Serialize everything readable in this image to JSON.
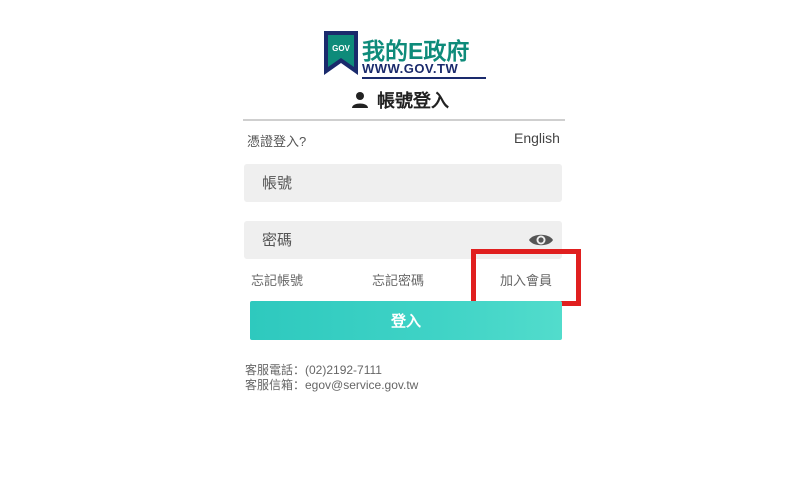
{
  "logo": {
    "emblem_text": "GOV",
    "name": "我的E政府",
    "url": "WWW.GOV.TW"
  },
  "title": "帳號登入",
  "cert_login": "憑證登入?",
  "language": "English",
  "form": {
    "account_placeholder": "帳號",
    "password_placeholder": "密碼"
  },
  "links": {
    "forgot_account": "忘記帳號",
    "forgot_password": "忘記密碼",
    "join": "加入會員"
  },
  "login_button": "登入",
  "service": {
    "phone": "客服電話：(02)2192-7111",
    "email": "客服信箱：egov@service.gov.tw"
  },
  "colors": {
    "brand_green": "#0e8b7a",
    "brand_navy": "#1a2a6c",
    "button": "#3fd3c6",
    "highlight": "#e01f1f"
  },
  "icons": {
    "title": "user-icon",
    "password_toggle": "eye-icon"
  }
}
